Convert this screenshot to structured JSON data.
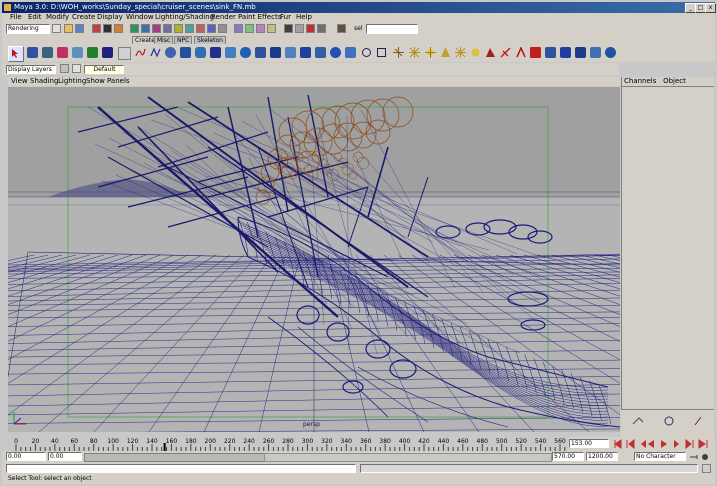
{
  "window": {
    "title": "Maya 3.0: D:\\WOH_works\\Sunday_special\\cruiser_scenes\\sink_FN.mb",
    "controls": [
      "_",
      "□",
      "x"
    ]
  },
  "menubar": {
    "items": [
      "File",
      "Edit",
      "Modify",
      "Create",
      "Display",
      "Window",
      "Lighting/Shading",
      "Render",
      "Paint Effects",
      "Fur",
      "Help"
    ]
  },
  "statusline": {
    "mode_menu": "Rendering",
    "sel_label": "sel",
    "sel_value": ""
  },
  "shelf": {
    "tabs": [
      "Create",
      "Misc",
      "NPC",
      "Skeleton"
    ],
    "active_tab": "Create"
  },
  "layerbar": {
    "layers_menu": "Display Layers",
    "default_layer": "Default"
  },
  "panel": {
    "menu": [
      "View",
      "Shading",
      "Lighting",
      "Show",
      "Panels"
    ],
    "camera_label": "persp"
  },
  "channelbox": {
    "tabs": [
      "Channels",
      "Object"
    ]
  },
  "timeslider": {
    "ticks": [
      "0",
      "20",
      "40",
      "60",
      "80",
      "100",
      "120",
      "140",
      "160",
      "180",
      "200",
      "220",
      "240",
      "260",
      "280",
      "300",
      "320",
      "340",
      "360",
      "380",
      "400",
      "420",
      "440",
      "460",
      "480",
      "500",
      "520",
      "540",
      "560"
    ],
    "current_frame": "153.00"
  },
  "rangebar": {
    "start_time": "0.00",
    "playback_start": "0.00",
    "playback_end": "570.00",
    "end_time": "1200.00",
    "character_set": "No Character"
  },
  "helpline": {
    "text": "Select Tool: select an object"
  },
  "colors": {
    "wireframe": "#1a1a7a",
    "fire": "#8a4a1a",
    "titlebar": "#0a246a",
    "panel_bg": "#d4d0c8",
    "viewport_bg": "#a8a8a8"
  }
}
